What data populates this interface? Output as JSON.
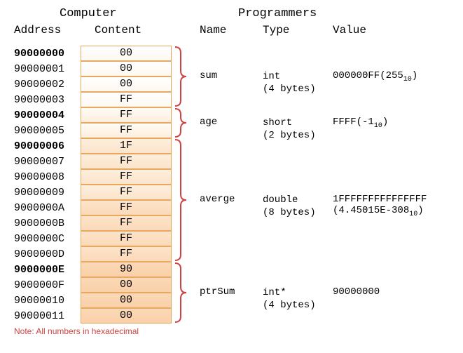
{
  "headers": {
    "computer": "Computer",
    "programmers": "Programmers",
    "address": "Address",
    "content": "Content",
    "name": "Name",
    "type": "Type",
    "value": "Value"
  },
  "rows": [
    {
      "addr": "90000000",
      "bold": true,
      "content": "00",
      "shade": 0
    },
    {
      "addr": "90000001",
      "bold": false,
      "content": "00",
      "shade": 0
    },
    {
      "addr": "90000002",
      "bold": false,
      "content": "00",
      "shade": 0
    },
    {
      "addr": "90000003",
      "bold": false,
      "content": "FF",
      "shade": 0
    },
    {
      "addr": "90000004",
      "bold": true,
      "content": "FF",
      "shade": 1
    },
    {
      "addr": "90000005",
      "bold": false,
      "content": "FF",
      "shade": 1
    },
    {
      "addr": "90000006",
      "bold": true,
      "content": "1F",
      "shade": 2
    },
    {
      "addr": "90000007",
      "bold": false,
      "content": "FF",
      "shade": 2
    },
    {
      "addr": "90000008",
      "bold": false,
      "content": "FF",
      "shade": 2
    },
    {
      "addr": "90000009",
      "bold": false,
      "content": "FF",
      "shade": 2
    },
    {
      "addr": "9000000A",
      "bold": false,
      "content": "FF",
      "shade": 3
    },
    {
      "addr": "9000000B",
      "bold": false,
      "content": "FF",
      "shade": 3
    },
    {
      "addr": "9000000C",
      "bold": false,
      "content": "FF",
      "shade": 3
    },
    {
      "addr": "9000000D",
      "bold": false,
      "content": "FF",
      "shade": 3
    },
    {
      "addr": "9000000E",
      "bold": true,
      "content": "90",
      "shade": 4
    },
    {
      "addr": "9000000F",
      "bold": false,
      "content": "00",
      "shade": 4
    },
    {
      "addr": "90000010",
      "bold": false,
      "content": "00",
      "shade": 4
    },
    {
      "addr": "90000011",
      "bold": false,
      "content": "00",
      "shade": 4
    }
  ],
  "vars": [
    {
      "name": "sum",
      "type": "int",
      "bytes": "(4 bytes)",
      "value_hex": "000000FF",
      "value_dec": "255",
      "has_dec": true,
      "start": 0,
      "span": 4
    },
    {
      "name": "age",
      "type": "short",
      "bytes": "(2 bytes)",
      "value_hex": "FFFF",
      "value_dec": "-1",
      "has_dec": true,
      "start": 4,
      "span": 2
    },
    {
      "name": "averge",
      "type": "double",
      "bytes": "(8 bytes)",
      "value_hex": "1FFFFFFFFFFFFFFF",
      "value_dec": "4.45015E-308",
      "has_dec": true,
      "start": 6,
      "span": 8
    },
    {
      "name": "ptrSum",
      "type": "int*",
      "bytes": "(4 bytes)",
      "value_hex": "90000000",
      "value_dec": "",
      "has_dec": false,
      "start": 14,
      "span": 4
    }
  ],
  "note": "Note: All numbers in hexadecimal",
  "sub_label": "10"
}
